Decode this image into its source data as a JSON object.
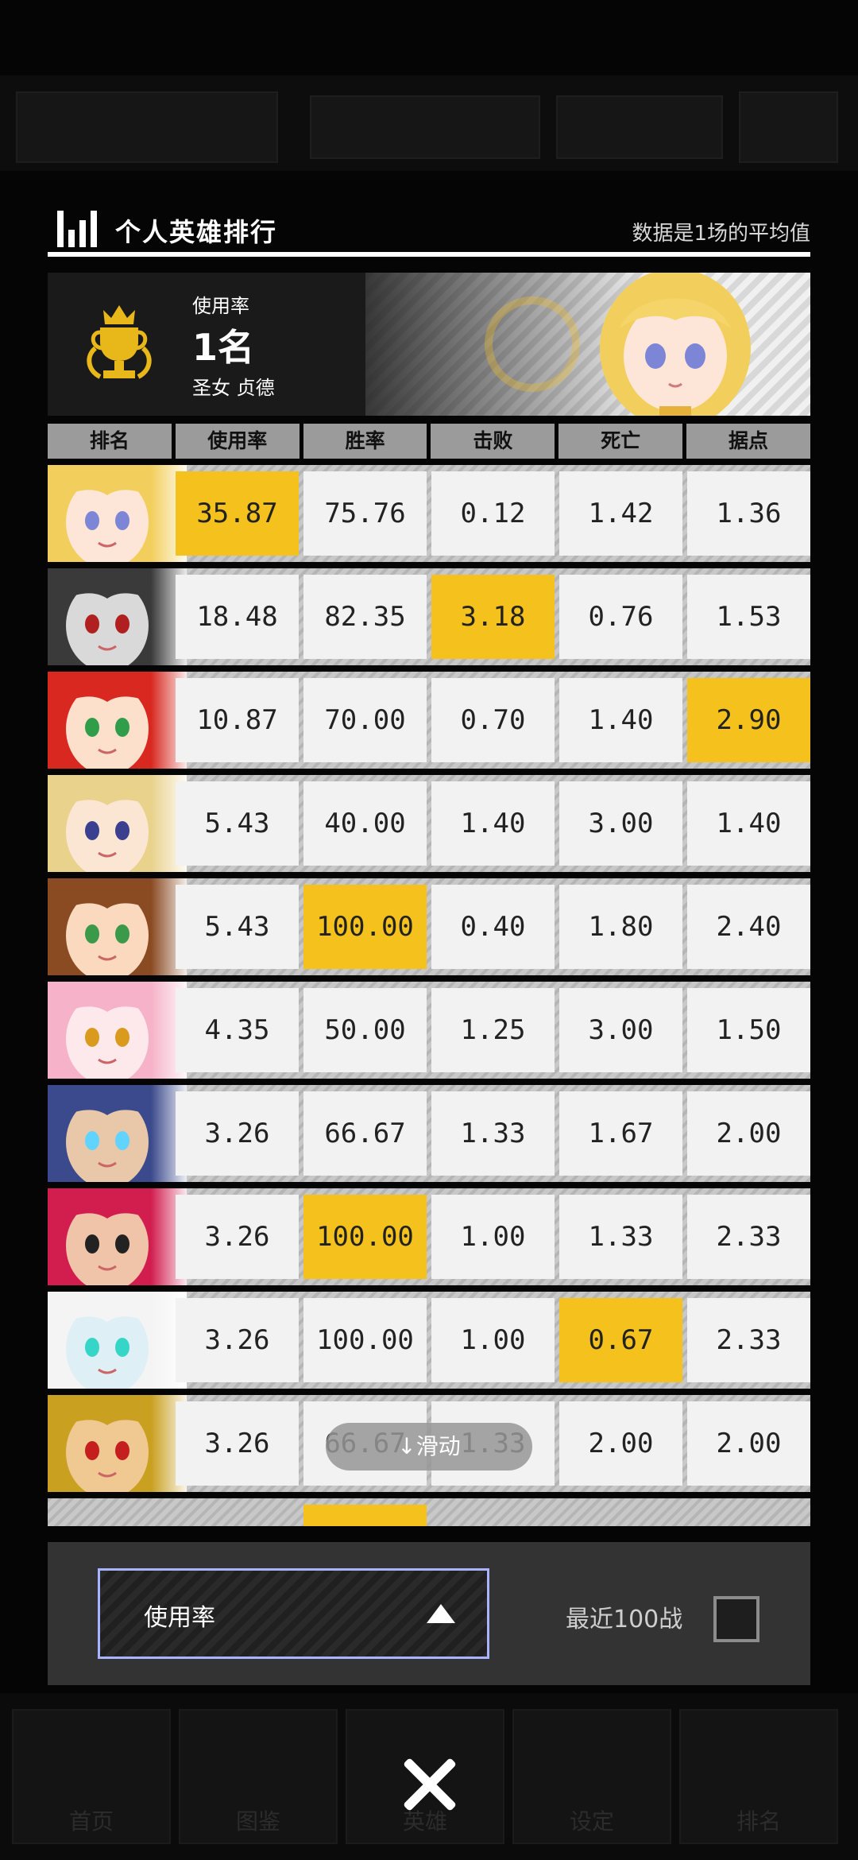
{
  "panel": {
    "title": "个人英雄排行",
    "note": "数据是1场的平均值"
  },
  "banner": {
    "label": "使用率",
    "rank": "1名",
    "hero_name": "圣女 贞德"
  },
  "table": {
    "headers": [
      "排名",
      "使用率",
      "胜率",
      "击败",
      "死亡",
      "据点"
    ],
    "rows": [
      {
        "values": [
          "35.87",
          "75.76",
          "0.12",
          "1.42",
          "1.36"
        ],
        "highlight": 0
      },
      {
        "values": [
          "18.48",
          "82.35",
          "3.18",
          "0.76",
          "1.53"
        ],
        "highlight": 2
      },
      {
        "values": [
          "10.87",
          "70.00",
          "0.70",
          "1.40",
          "2.90"
        ],
        "highlight": 4
      },
      {
        "values": [
          "5.43",
          "40.00",
          "1.40",
          "3.00",
          "1.40"
        ],
        "highlight": -1
      },
      {
        "values": [
          "5.43",
          "100.00",
          "0.40",
          "1.80",
          "2.40"
        ],
        "highlight": 1
      },
      {
        "values": [
          "4.35",
          "50.00",
          "1.25",
          "3.00",
          "1.50"
        ],
        "highlight": -1
      },
      {
        "values": [
          "3.26",
          "66.67",
          "1.33",
          "1.67",
          "2.00"
        ],
        "highlight": -1
      },
      {
        "values": [
          "3.26",
          "100.00",
          "1.00",
          "1.33",
          "2.33"
        ],
        "highlight": 1
      },
      {
        "values": [
          "3.26",
          "100.00",
          "1.00",
          "0.67",
          "2.33"
        ],
        "highlight": 3
      },
      {
        "values": [
          "3.26",
          "66.67",
          "1.33",
          "2.00",
          "2.00"
        ],
        "highlight": -1
      }
    ]
  },
  "scroll_hint": "↓滑动",
  "filter": {
    "dropdown_label": "使用率",
    "recent_label": "最近100战",
    "recent_checked": false
  },
  "bottom_tabs": [
    "首页",
    "图鉴",
    "英雄",
    "设定",
    "排名"
  ],
  "colors": {
    "highlight": "#f5c21d",
    "dropdown_border": "#a8b4ff"
  }
}
